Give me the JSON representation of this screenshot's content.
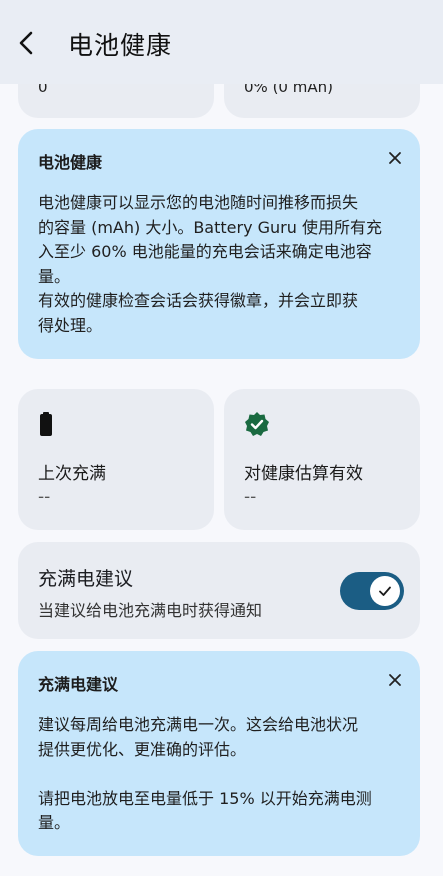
{
  "header": {
    "title": "电池健康"
  },
  "top_stats": {
    "left_value": "0",
    "right_value": "0% (0 mAh)"
  },
  "health_info": {
    "title": "电池健康",
    "lines": [
      "电池健康可以显示您的电池随时间推移而损失",
      "的容量 (mAh) 大小。Battery Guru 使用所有充",
      "入至少 60% 电池能量的充电会话来确定电池容",
      "量。",
      "有效的健康检查会话会获得徽章，并会立即获",
      "得处理。"
    ]
  },
  "stats": {
    "last_charge": {
      "label": "上次充满",
      "value": "--",
      "icon": "battery-full-icon"
    },
    "valid_estimate": {
      "label": "对健康估算有效",
      "value": "--",
      "icon": "verified-badge-icon"
    }
  },
  "full_charge_setting": {
    "title": "充满电建议",
    "subtitle": "当建议给电池充满电时获得通知",
    "enabled": true,
    "accent": "#1b5d84"
  },
  "full_charge_info": {
    "title": "充满电建议",
    "lines": [
      "建议每周给电池充满电一次。这会给电池状况",
      "提供更优化、更准确的评估。",
      "",
      "请把电池放电至电量低于 15% 以开始充满电测",
      "量。"
    ]
  }
}
